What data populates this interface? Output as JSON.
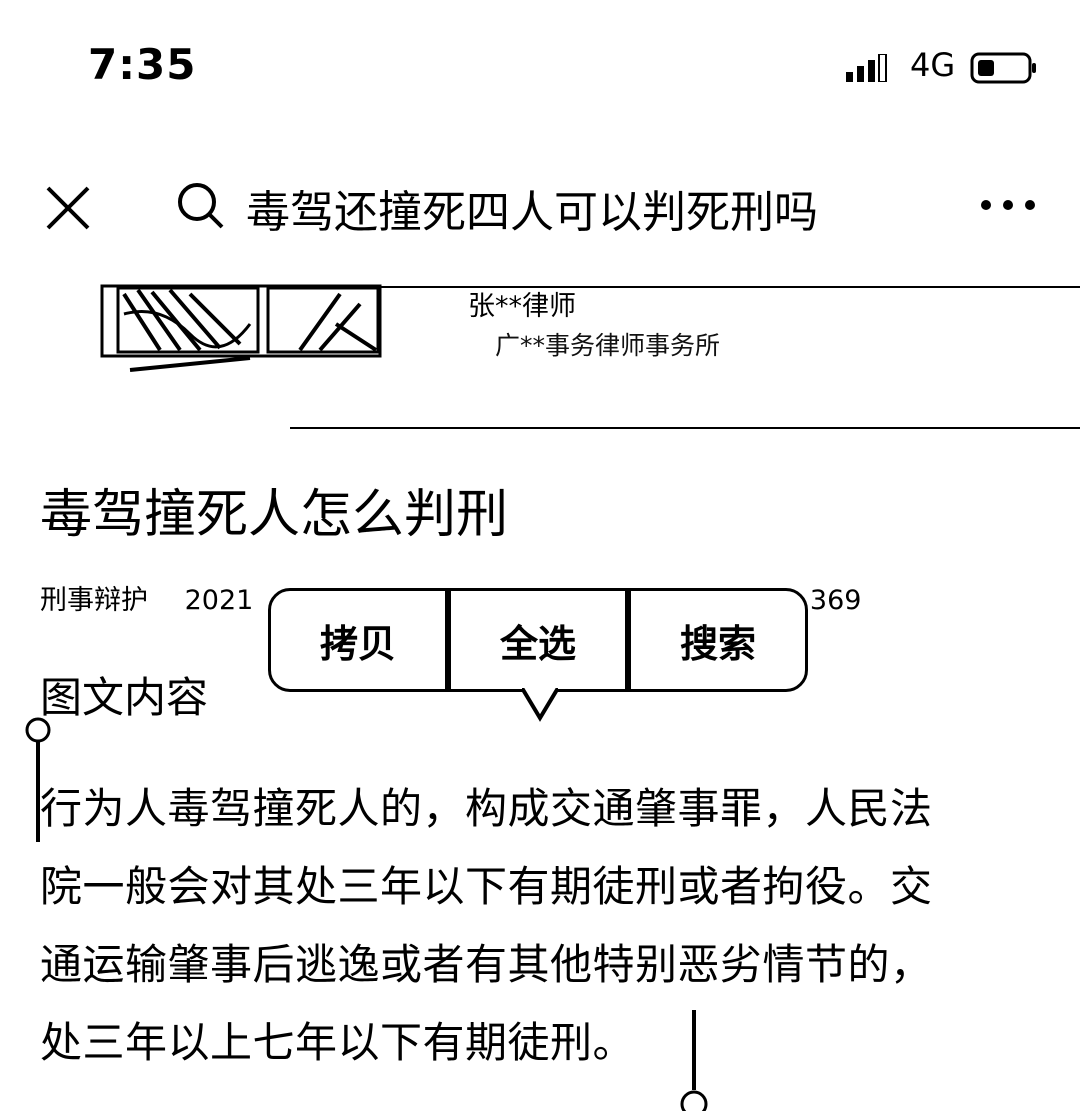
{
  "status_bar": {
    "time": "7:35",
    "network": "4G",
    "signal_icon": "cellular-signal-icon",
    "battery_icon": "battery-icon"
  },
  "search_bar": {
    "close_icon": "close-icon",
    "search_icon": "search-icon",
    "query": "毒驾还撞死四人可以判死刑吗",
    "more_icon": "more-icon"
  },
  "lawyer_card": {
    "name": "张**律师",
    "firm": "广**事务律师事务所"
  },
  "article": {
    "title": "毒驾撞死人怎么判刑",
    "meta": {
      "category": "刑事辩护",
      "date": "2021",
      "count": "369"
    },
    "section_title": "图文内容",
    "body_lines": [
      "行为人毒驾撞死人的，构成交通肇事罪，人民法",
      "院一般会对其处三年以下有期徒刑或者拘役。交",
      "通运输肇事后逃逸或者有其他特别恶劣情节的，",
      "处三年以上七年以下有期徒刑。"
    ]
  },
  "context_menu": {
    "copy": "拷贝",
    "select_all": "全选",
    "search": "搜索"
  },
  "colors": {
    "foreground": "#000000",
    "background": "#ffffff"
  }
}
